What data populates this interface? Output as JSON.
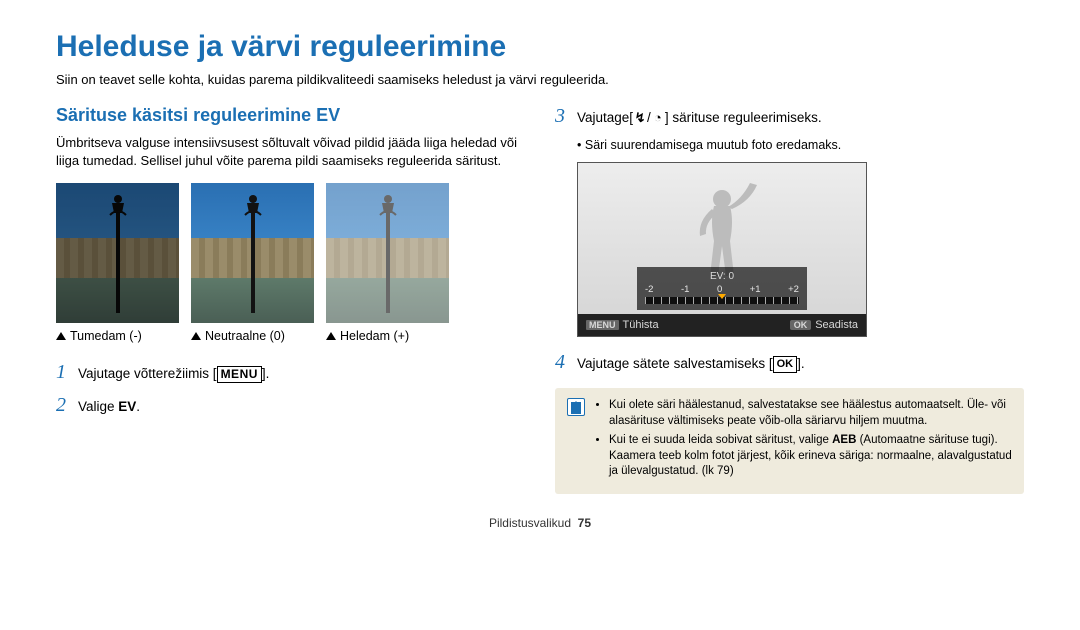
{
  "page": {
    "title": "Heleduse ja värvi reguleerimine",
    "intro": "Siin on teavet selle kohta, kuidas parema pildikvaliteedi saamiseks heledust ja värvi reguleerida.",
    "footer": "Pildistusvalikud",
    "footer_page": "75"
  },
  "left": {
    "subheader": "Särituse käsitsi reguleerimine EV",
    "para": "Ümbritseva valguse intensiivsusest sõltuvalt võivad pildid jääda liiga heledad või liiga tumedad. Sellisel juhul võite parema pildi saamiseks reguleerida säritust.",
    "captions": [
      "Tumedam (-)",
      "Neutraalne (0)",
      "Heledam (+)"
    ],
    "step1": "Vajutage võtterežiimis [",
    "step1_end": "].",
    "menu_label": "MENU",
    "step2_a": "Valige ",
    "step2_b": "EV",
    "step2_c": "."
  },
  "right": {
    "step3_a": "Vajutage[",
    "flash_icon": "↯",
    "slash": "/",
    "timer_icon": "◔",
    "step3_b": "] särituse reguleerimiseks.",
    "bullet3": "Säri suurendamisega muutub foto eredamaks.",
    "lcd": {
      "ev_label": "EV: 0",
      "scale": [
        "-2",
        "-1",
        "0",
        "+1",
        "+2"
      ],
      "menu_tag": "MENU",
      "cancel": "Tühista",
      "ok_tag": "OK",
      "set": "Seadista"
    },
    "step4_a": "Vajutage sätete salvestamiseks [",
    "ok_label": "OK",
    "step4_b": "].",
    "notes": [
      "Kui olete säri häälestanud, salvestatakse see häälestus automaatselt. Üle- või alasärituse vältimiseks peate võib-olla säriarvu hiljem muutma.",
      "Kui te ei suuda leida sobivat säritust, valige AEB (Automaatne särituse tugi). Kaamera teeb kolm fotot järjest, kõik erineva säriga: normaalne, alavalgustatud ja ülevalgustatud. (lk 79)"
    ],
    "note_bold": "AEB"
  }
}
